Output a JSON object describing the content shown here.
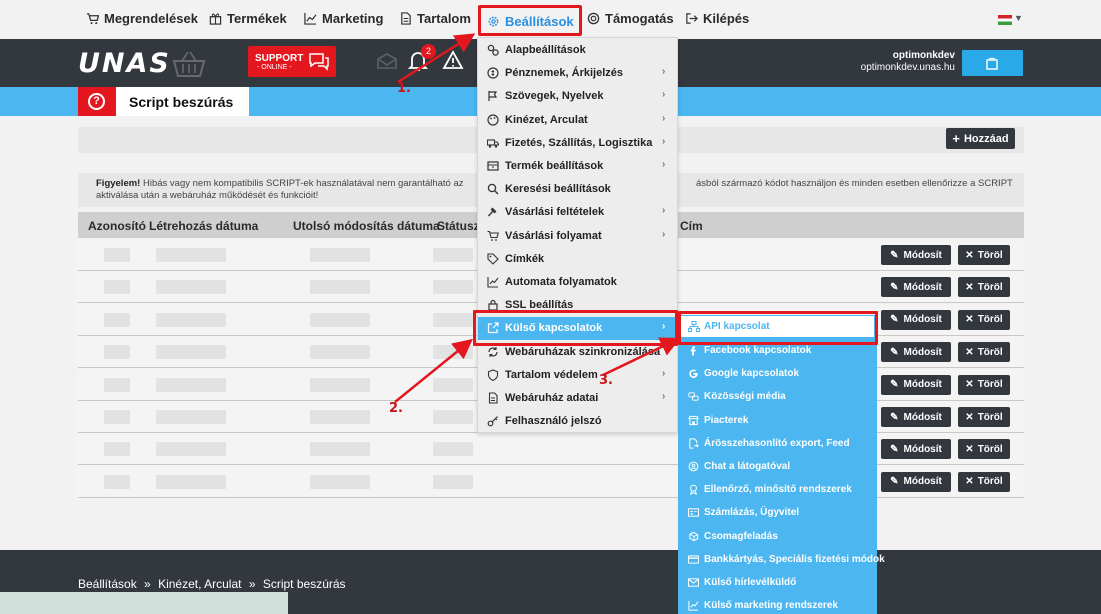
{
  "top_menu": {
    "items": [
      {
        "label": "Megrendelések",
        "icon": "cart-icon"
      },
      {
        "label": "Termékek",
        "icon": "gift-icon"
      },
      {
        "label": "Marketing",
        "icon": "chart-icon"
      },
      {
        "label": "Tartalom",
        "icon": "document-icon"
      },
      {
        "label": "Beállítások",
        "icon": "gear-icon"
      },
      {
        "label": "Támogatás",
        "icon": "lifebuoy-icon"
      },
      {
        "label": "Kilépés",
        "icon": "logout-icon"
      }
    ],
    "active_color": "#2a8fe0"
  },
  "header": {
    "logo": "UNAS",
    "support_label": "SUPPORT",
    "support_status": "- ONLINE -",
    "notification_count": "2",
    "user_name": "optimonkdev",
    "user_domain": "optimonkdev.unas.hu"
  },
  "page": {
    "title": "Script beszúrás",
    "add_button": "Hozzáad",
    "warning_label": "Figyelem!",
    "warning_text": "Hibás vagy nem kompatibilis SCRIPT-ek használatával nem garantálható az",
    "warning_text_right": "ásból származó kódot használjon és minden esetben ellenőrizze a SCRIPT",
    "warning_text_2": "aktiválása után a webáruház működését és funkcióit!"
  },
  "table": {
    "columns": [
      "Azonosító",
      "Létrehozás dátuma",
      "Utolsó módosítás dátuma",
      "Státusz",
      "Cím"
    ],
    "row_count": 8,
    "edit_label": "Módosít",
    "delete_label": "Töröl"
  },
  "settings_menu": {
    "items": [
      {
        "label": "Alapbeállítások",
        "icon": "gears-icon",
        "submenu": false
      },
      {
        "label": "Pénznemek, Árkijelzés",
        "icon": "coin-icon",
        "submenu": true
      },
      {
        "label": "Szövegek, Nyelvek",
        "icon": "flag-icon",
        "submenu": true
      },
      {
        "label": "Kinézet, Arculat",
        "icon": "palette-icon",
        "submenu": true
      },
      {
        "label": "Fizetés, Szállítás, Logisztika",
        "icon": "truck-icon",
        "submenu": true
      },
      {
        "label": "Termék beállítások",
        "icon": "box-icon",
        "submenu": true
      },
      {
        "label": "Keresési beállítások",
        "icon": "search-icon",
        "submenu": false
      },
      {
        "label": "Vásárlási feltételek",
        "icon": "gavel-icon",
        "submenu": true
      },
      {
        "label": "Vásárlási folyamat",
        "icon": "cart-icon",
        "submenu": true
      },
      {
        "label": "Címkék",
        "icon": "tag-icon",
        "submenu": false
      },
      {
        "label": "Automata folyamatok",
        "icon": "chart-icon",
        "submenu": false
      },
      {
        "label": "SSL beállítás",
        "icon": "lock-icon",
        "submenu": false
      },
      {
        "label": "Külső kapcsolatok",
        "icon": "external-link-icon",
        "submenu": true
      },
      {
        "label": "Webáruházak szinkronizálása",
        "icon": "sync-icon",
        "submenu": false
      },
      {
        "label": "Tartalom védelem",
        "icon": "shield-icon",
        "submenu": true
      },
      {
        "label": "Webáruház adatai",
        "icon": "document-icon",
        "submenu": true
      },
      {
        "label": "Felhasználó jelszó",
        "icon": "key-icon",
        "submenu": false
      }
    ],
    "highlight_color": "#4bb6ef"
  },
  "external_menu": {
    "items": [
      {
        "label": "API kapcsolat",
        "icon": "sitemap-icon"
      },
      {
        "label": "Facebook kapcsolatok",
        "icon": "facebook-icon"
      },
      {
        "label": "Google kapcsolatok",
        "icon": "google-icon"
      },
      {
        "label": "Közösségi média",
        "icon": "share-icon"
      },
      {
        "label": "Piacterek",
        "icon": "store-icon"
      },
      {
        "label": "Árösszehasonlító export, Feed",
        "icon": "export-icon"
      },
      {
        "label": "Chat a látogatóval",
        "icon": "chat-icon"
      },
      {
        "label": "Ellenőrző, minősítő rendszerek",
        "icon": "award-icon"
      },
      {
        "label": "Számlázás, Ügyvitel",
        "icon": "invoice-icon"
      },
      {
        "label": "Csomagfeladás",
        "icon": "package-icon"
      },
      {
        "label": "Bankkártyás, Speciális fizetési módok",
        "icon": "credit-card-icon"
      },
      {
        "label": "Külső hírlevélküldő",
        "icon": "mail-icon"
      },
      {
        "label": "Külső marketing rendszerek",
        "icon": "chart-icon"
      }
    ]
  },
  "annotations": {
    "step1": "1.",
    "step2": "2.",
    "step3": "3.",
    "color": "#e4161e"
  },
  "breadcrumb": {
    "items": [
      "Beállítások",
      "Kinézet, Arculat",
      "Script beszúrás"
    ],
    "separator": "»"
  }
}
